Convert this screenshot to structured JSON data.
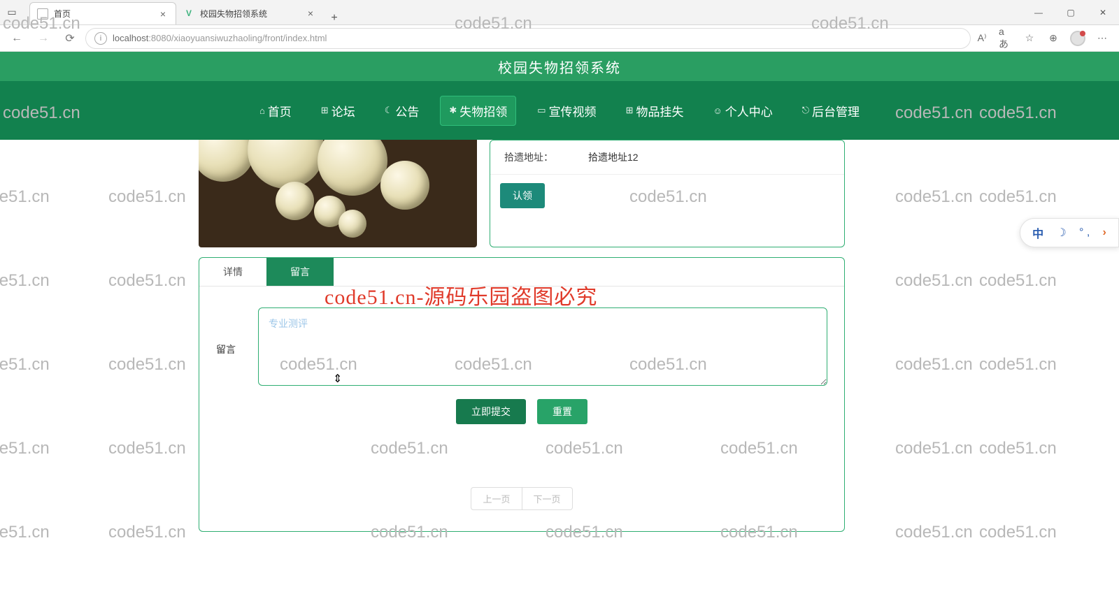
{
  "browser": {
    "tabs": [
      {
        "title": "首页",
        "active": true,
        "favicon": "doc"
      },
      {
        "title": "校园失物招领系统",
        "active": false,
        "favicon": "vue"
      }
    ],
    "url_host": "localhost",
    "url_port": ":8080",
    "url_path": "/xiaoyuansiwuzhaoling/front/index.html"
  },
  "site": {
    "title": "校园失物招领系统",
    "nav": [
      {
        "icon": "⌂",
        "label": "首页"
      },
      {
        "icon": "⊞",
        "label": "论坛"
      },
      {
        "icon": "☾",
        "label": "公告"
      },
      {
        "icon": "✱",
        "label": "失物招领",
        "active": true
      },
      {
        "icon": "▭",
        "label": "宣传视频"
      },
      {
        "icon": "⊞",
        "label": "物品挂失"
      },
      {
        "icon": "☺",
        "label": "个人中心"
      },
      {
        "icon": "⎋",
        "label": "后台管理"
      }
    ]
  },
  "detail": {
    "field_label": "拾遗地址：",
    "field_value": "拾遗地址12",
    "claim_btn": "认领"
  },
  "panel": {
    "tab_detail": "详情",
    "tab_comment": "留言",
    "form_label": "留言",
    "placeholder": "专业测评",
    "submit": "立即提交",
    "reset": "重置",
    "prev": "上一页",
    "next": "下一页"
  },
  "watermark": {
    "text": "code51.cn",
    "banner": "code51.cn-源码乐园盗图必究"
  },
  "ime": {
    "zh": "中"
  }
}
